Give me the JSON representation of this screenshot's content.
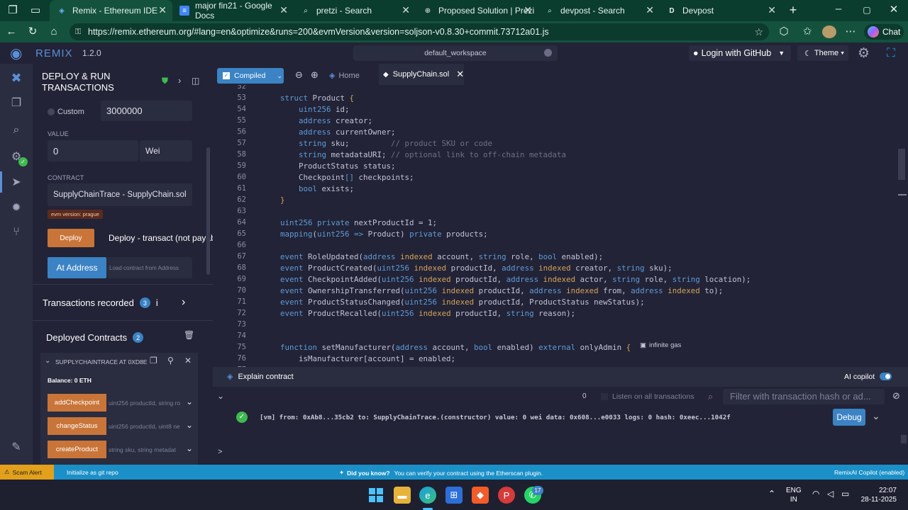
{
  "browser": {
    "tabs": [
      {
        "title": "Remix - Ethereum IDE",
        "icon": "remix-icon"
      },
      {
        "title": "major fin21 - Google Docs",
        "icon": "docs-icon"
      },
      {
        "title": "pretzi - Search",
        "icon": "search-icon"
      },
      {
        "title": "Proposed Solution | Prezi",
        "icon": "globe-icon"
      },
      {
        "title": "devpost - Search",
        "icon": "search-icon"
      },
      {
        "title": "Devpost",
        "icon": "devpost-icon"
      }
    ],
    "url": "https://remix.ethereum.org/#lang=en&optimize&runs=200&evmVersion&version=soljson-v0.8.30+commit.73712a01.js",
    "chat_label": "Chat"
  },
  "remix": {
    "brand": "REMIX",
    "version": "1.2.0",
    "workspace": "default_workspace",
    "login_label": "Login with GitHub",
    "theme_label": "Theme",
    "accent": "#c97539",
    "blue": "#1b90c8"
  },
  "side": {
    "title_line1": "DEPLOY & RUN",
    "title_line2": "TRANSACTIONS",
    "custom_label": "Custom",
    "gas_value": "3000000",
    "value_label": "VALUE",
    "value_amount": "0",
    "value_unit": "Wei",
    "contract_label": "CONTRACT",
    "contract_value": "SupplyChainTrace - SupplyChain.sol",
    "evm_badge": "evm version: prague",
    "deploy_label": "Deploy",
    "deploy_hint": "Deploy - transact (not payable)",
    "at_address_label": "At Address",
    "at_address_placeholder": "Load contract from Address",
    "transactions_label": "Transactions recorded",
    "transactions_count": "3",
    "deployed_label": "Deployed Contracts",
    "deployed_count": "2",
    "instance_name": "SUPPLYCHAINTRACE AT 0XD8E",
    "balance": "Balance: 0 ETH",
    "functions": [
      {
        "name": "addCheckpoint",
        "params": "uint256 productId, string ro"
      },
      {
        "name": "changeStatus",
        "params": "uint256 productId, uint8 ne"
      },
      {
        "name": "createProduct",
        "params": "string sku, string metadat"
      }
    ]
  },
  "editor": {
    "compiled_label": "Compiled",
    "home_label": "Home",
    "file_tab": "SupplyChain.sol",
    "gas_hint": "infinite gas",
    "line_numbers": [
      "52",
      "53",
      "54",
      "55",
      "56",
      "57",
      "58",
      "59",
      "60",
      "61",
      "62",
      "63",
      "64",
      "65",
      "66",
      "67",
      "68",
      "69",
      "70",
      "71",
      "72",
      "73",
      "74",
      "75",
      "76",
      "77"
    ]
  },
  "terminal": {
    "explain_label": "Explain contract",
    "copilot_label": "AI copilot",
    "count": "0",
    "listen_label": "Listen on all transactions",
    "filter_placeholder": "Filter with transaction hash or ad...",
    "log": "[vm]  from: 0xAb8...35cb2 to: SupplyChainTrace.(constructor) value: 0 wei data: 0x608...e0033 logs: 0 hash: 0xeec...1042f",
    "debug_label": "Debug",
    "prompt": ">"
  },
  "status": {
    "scam_alert": "Scam Alert",
    "git_label": "Initialize as git repo",
    "did_you_know": "Did you know?",
    "tip": "You can verify your contract using the Etherscan plugin.",
    "copilot_status": "RemixAI Copilot (enabled)"
  },
  "taskbar": {
    "lang1": "ENG",
    "lang2": "IN",
    "time": "22:07",
    "date": "28-11-2025",
    "whatsapp_badge": "17"
  }
}
